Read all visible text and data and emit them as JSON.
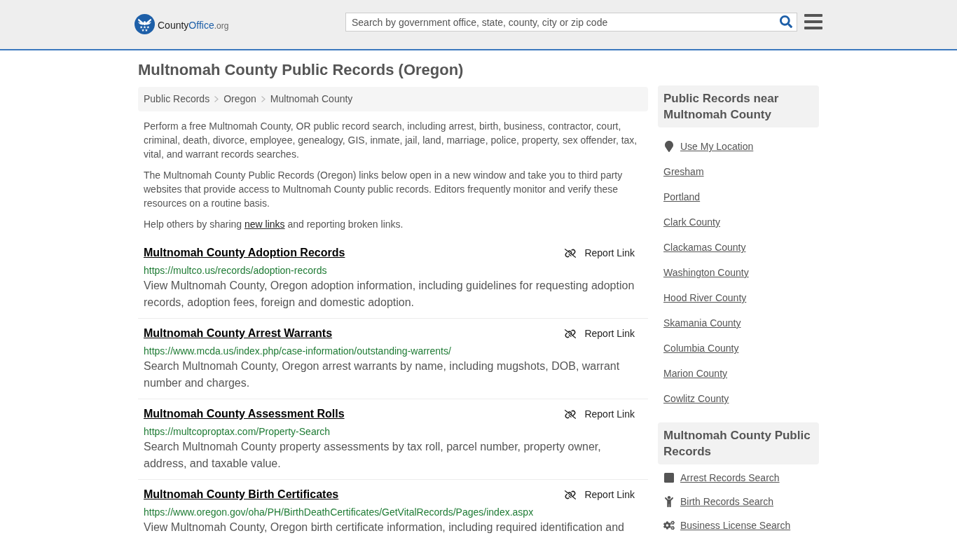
{
  "header": {
    "logo": {
      "parts": [
        {
          "text": "County",
          "kind": "plain"
        },
        {
          "text": "Office",
          "kind": "accent"
        },
        {
          "text": ".org",
          "kind": "suffix"
        }
      ]
    },
    "search": {
      "placeholder": "Search by government office, state, county, city or zip code"
    }
  },
  "page_title": "Multnomah County Public Records (Oregon)",
  "breadcrumb": [
    "Public Records",
    "Oregon",
    "Multnomah County"
  ],
  "intro": {
    "paragraphs": [
      "Perform a free Multnomah County, OR public record search, including arrest, birth, business, contractor, court, criminal, death, divorce, employee, genealogy, GIS, inmate, jail, land, marriage, police, property, sex offender, tax, vital, and warrant records searches.",
      "The Multnomah County Public Records (Oregon) links below open in a new window and take you to third party websites that provide access to Multnomah County public records. Editors frequently monitor and verify these resources on a routine basis."
    ],
    "help": {
      "before": "Help others by sharing ",
      "link": "new links",
      "after": " and reporting broken links."
    }
  },
  "records": [
    {
      "title": "Multnomah County Adoption Records",
      "url": "https://multco.us/records/adoption-records",
      "description": "View Multnomah County, Oregon adoption information, including guidelines for requesting adoption records, adoption fees, foreign and domestic adoption.",
      "report_label": "Report Link"
    },
    {
      "title": "Multnomah County Arrest Warrants",
      "url": "https://www.mcda.us/index.php/case-information/outstanding-warrents/",
      "description": "Search Multnomah County, Oregon arrest warrants by name, including mugshots, DOB, warrant number and charges.",
      "report_label": "Report Link"
    },
    {
      "title": "Multnomah County Assessment Rolls",
      "url": "https://multcoproptax.com/Property-Search",
      "description": "Search Multnomah County property assessments by tax roll, parcel number, property owner, address, and taxable value.",
      "report_label": "Report Link"
    },
    {
      "title": "Multnomah County Birth Certificates",
      "url": "https://www.oregon.gov/oha/PH/BirthDeathCertificates/GetVitalRecords/Pages/index.aspx",
      "description": "View Multnomah County, Oregon birth certificate information, including required identification and",
      "report_label": "Report Link"
    }
  ],
  "sidebar": {
    "nearby": {
      "heading": "Public Records near Multnomah County",
      "items": [
        {
          "label": "Use My Location",
          "kind": "location"
        },
        {
          "label": "Gresham",
          "kind": "place"
        },
        {
          "label": "Portland",
          "kind": "place"
        },
        {
          "label": "Clark County",
          "kind": "place"
        },
        {
          "label": "Clackamas County",
          "kind": "place"
        },
        {
          "label": "Washington County",
          "kind": "place"
        },
        {
          "label": "Hood River County",
          "kind": "place"
        },
        {
          "label": "Skamania County",
          "kind": "place"
        },
        {
          "label": "Columbia County",
          "kind": "place"
        },
        {
          "label": "Marion County",
          "kind": "place"
        },
        {
          "label": "Cowlitz County",
          "kind": "place"
        }
      ]
    },
    "county_records": {
      "heading": "Multnomah County Public Records",
      "items": [
        {
          "label": "Arrest Records Search",
          "kind": "arrest"
        },
        {
          "label": "Birth Records Search",
          "kind": "birth"
        },
        {
          "label": "Business License Search",
          "kind": "business"
        }
      ]
    }
  }
}
